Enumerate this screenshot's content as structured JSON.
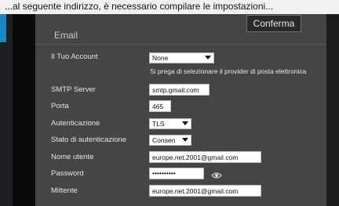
{
  "top_caption": "...al seguente indirizzo, è necessario compilare le impostazioni...",
  "panel": {
    "title": "Email",
    "confirm_label": "Conferma"
  },
  "form": {
    "account": {
      "label": "Il Tuo Account",
      "value": "None",
      "hint": "Si prega di selezionare il provider di posta elettronica"
    },
    "smtp": {
      "label": "SMTP Server",
      "value": "smtp.gmail.com"
    },
    "port": {
      "label": "Porta",
      "value": "465"
    },
    "auth": {
      "label": "Autenticazione",
      "value": "TLS"
    },
    "auth_state": {
      "label": "Stato di autenticazione",
      "value": "Consen"
    },
    "username": {
      "label": "Nome utente",
      "value": "europe.net.2001@gmail.com"
    },
    "password": {
      "label": "Password",
      "value": "••••••••••"
    },
    "sender": {
      "label": "Mittente",
      "value": "europe.net.2001@gmail.com"
    }
  },
  "icons": {
    "password_toggle": "eye-icon"
  },
  "colors": {
    "accent": "#1a87c9",
    "panel_bg": "#454545"
  }
}
